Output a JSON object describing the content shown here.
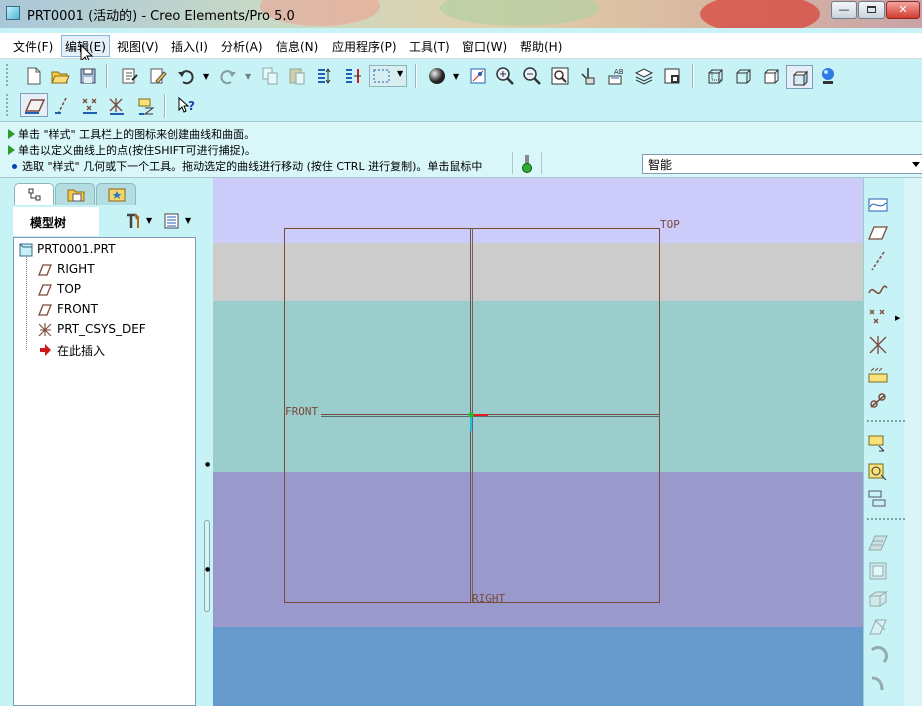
{
  "window": {
    "title": "PRT0001 (活动的) - Creo Elements/Pro 5.0",
    "minimize": "—",
    "close": "✕"
  },
  "menu": [
    {
      "id": "file",
      "label": "文件(F)"
    },
    {
      "id": "edit",
      "label": "编辑(E)"
    },
    {
      "id": "view",
      "label": "视图(V)"
    },
    {
      "id": "insert",
      "label": "插入(I)"
    },
    {
      "id": "analysis",
      "label": "分析(A)"
    },
    {
      "id": "info",
      "label": "信息(N)"
    },
    {
      "id": "apps",
      "label": "应用程序(P)"
    },
    {
      "id": "tools",
      "label": "工具(T)"
    },
    {
      "id": "window",
      "label": "窗口(W)"
    },
    {
      "id": "help",
      "label": "帮助(H)"
    }
  ],
  "toolbar": {
    "row1": [
      "new-icon",
      "open-icon",
      "save-icon",
      "regenerate-icon",
      "edit-definition-icon",
      "undo-icon",
      "redo-icon",
      "copy-icon",
      "paste-icon",
      "paste-special-icon",
      "mirror-icon",
      "select-box-icon",
      "shading-icon",
      "view-manager-icon",
      "zoom-in-icon",
      "zoom-out-icon",
      "refit-icon",
      "orient-icon",
      "reorient-icon",
      "layers-icon",
      "saved-views-icon",
      "wireframe-icon",
      "hidden-line-icon",
      "no-hidden-icon",
      "shaded-icon",
      "appearance-icon"
    ],
    "row2": [
      "datum-plane-display-icon",
      "datum-axis-display-icon",
      "datum-point-display-icon",
      "csys-display-icon",
      "annotation-display-icon",
      "whats-this-icon"
    ]
  },
  "messages": [
    {
      "type": "arrow",
      "text": "单击 \"样式\" 工具栏上的图标来创建曲线和曲面。"
    },
    {
      "type": "arrow",
      "text": "单击以定义曲线上的点(按住SHIFT可进行捕捉)。"
    },
    {
      "type": "dot",
      "text": "选取 \"样式\" 几何或下一个工具。拖动选定的曲线进行移动 (按住 CTRL 进行复制)。单击鼠标中"
    }
  ],
  "filter": {
    "value": "智能"
  },
  "navigator": {
    "tabs": [
      "model-tree-tab-icon",
      "folder-browser-tab-icon",
      "favorites-tab-icon"
    ],
    "header": "模型树",
    "tree": [
      {
        "label": "PRT0001.PRT",
        "icon": "part-icon",
        "indent": 0
      },
      {
        "label": "RIGHT",
        "icon": "datum-plane-icon",
        "indent": 1
      },
      {
        "label": "TOP",
        "icon": "datum-plane-icon",
        "indent": 1
      },
      {
        "label": "FRONT",
        "icon": "datum-plane-icon",
        "indent": 1
      },
      {
        "label": "PRT_CSYS_DEF",
        "icon": "csys-icon",
        "indent": 1
      },
      {
        "label": "在此插入",
        "icon": "insert-here-icon",
        "indent": 1
      }
    ]
  },
  "graphics": {
    "datum_labels": {
      "top": "TOP",
      "front": "FRONT",
      "right": "RIGHT"
    },
    "band_colors": [
      "#cccbf9",
      "#cccccc",
      "#9ccdcd",
      "#9999cc",
      "#6699cc"
    ],
    "datum_color": "#7a4a3a"
  },
  "right_toolbar": [
    "style-curve-icon",
    "style-plane-icon",
    "style-line-icon",
    "free-curve-icon",
    "datum-points-icon",
    "csys-style-icon",
    "curve-on-surface-icon",
    "link-icon",
    "drop-curve-icon",
    "intersect-curve-icon",
    "offset-curve-icon",
    "boundary-surface-icon",
    "surface-trim-icon",
    "surface-merge-icon",
    "curve-edit-icon",
    "rotate-icon",
    "sweep-icon"
  ]
}
